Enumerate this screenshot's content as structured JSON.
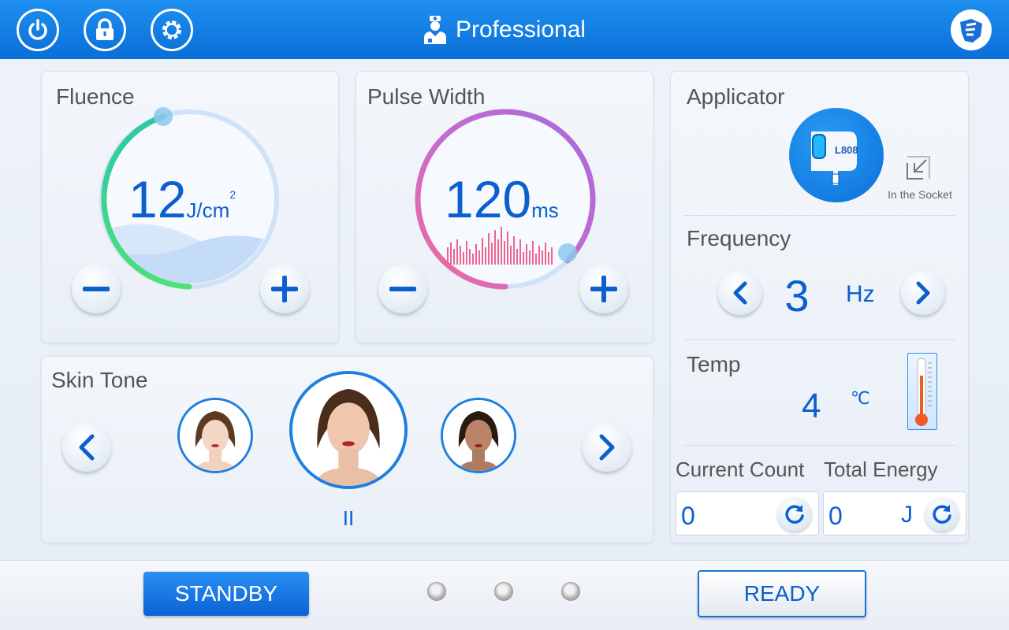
{
  "header": {
    "mode_label": "Professional",
    "icons": [
      "power-icon",
      "lock-icon",
      "settings-icon",
      "doctor-icon",
      "brand-logo"
    ]
  },
  "fluence": {
    "title": "Fluence",
    "value": "12",
    "unit": "J/cm",
    "unit_sup": "2",
    "level_fraction": 0.35
  },
  "pulse_width": {
    "title": "Pulse Width",
    "value": "120",
    "unit": "ms",
    "level_fraction": 0.62
  },
  "skin_tone": {
    "title": "Skin Tone",
    "selected_level": "II",
    "options": [
      "light",
      "medium",
      "dark"
    ]
  },
  "applicator": {
    "title": "Applicator",
    "model": "L808",
    "status": "In the Socket"
  },
  "frequency": {
    "title": "Frequency",
    "value": "3",
    "unit": "Hz"
  },
  "temp": {
    "title": "Temp",
    "value": "4",
    "unit": "℃"
  },
  "counters": {
    "current_count_label": "Current Count",
    "current_count_value": "0",
    "total_energy_label": "Total Energy",
    "total_energy_value": "0",
    "total_energy_unit": "J"
  },
  "footer": {
    "standby_label": "STANDBY",
    "ready_label": "READY"
  },
  "colors": {
    "accent": "#0b5fcf",
    "topbar": "#1e8ff0",
    "fluence_arc_start": "#3dd68c",
    "pulse_arc_start": "#f06b9a",
    "pulse_arc_end": "#a86bd6"
  }
}
